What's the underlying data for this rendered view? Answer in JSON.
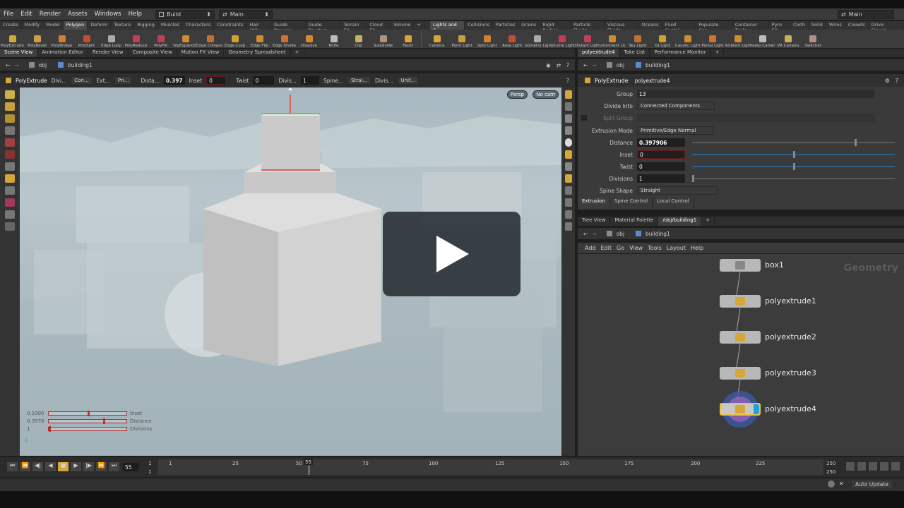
{
  "menubar": {
    "items": [
      "File",
      "Edit",
      "Render",
      "Assets",
      "Windows",
      "Help"
    ],
    "desktop": "Build",
    "desktop_icon": "grid-icon",
    "session": "Main",
    "right_session": "Main"
  },
  "shelf_tabs_left": [
    "Create",
    "Modify",
    "Model",
    "Polygon",
    "Deform",
    "Texture",
    "Rigging",
    "Muscles",
    "Characters",
    "Constraints",
    "Hair Utils",
    "Guide Process",
    "Guide Brushes",
    "Terrain FX",
    "Cloud FX",
    "Volume"
  ],
  "shelf_tabs_right": [
    "Lights and C...",
    "Collisions",
    "Particles",
    "Grains",
    "Rigid Bodies",
    "Particle Fluids",
    "Viscous Fluids",
    "Oceans",
    "Fluid Contai...",
    "Populate Con...",
    "Container Tools",
    "Pyro FX",
    "Cloth",
    "Solid",
    "Wires",
    "Crowds",
    "Drive Simula..."
  ],
  "shelf_tools_left": [
    "PolyExtrude",
    "PolyBevel",
    "PolyBridge",
    "PolySplit",
    "Edge Loop",
    "PolyReduce",
    "PolyFill",
    "PolyExpand2D",
    "Edge Collapse",
    "Edge Cusp",
    "Edge Flip",
    "Edge Divide",
    "Dissolve",
    "Knife",
    "Clip",
    "Subdivide",
    "Facet"
  ],
  "shelf_tools_right": [
    "Camera",
    "Point Light",
    "Spot Light",
    "Area Light",
    "Geometry Light",
    "Volume Light",
    "Distant Light",
    "Environment Light",
    "Sky Light",
    "GI Light",
    "Caustic Light",
    "Portal Light",
    "Ambient Light",
    "Stereo Camera",
    "VR Camera",
    "Switcher"
  ],
  "left_pane_tabs": [
    "Scene View",
    "Animation Editor",
    "Render View",
    "Composite View",
    "Motion FX View",
    "Geometry Spreadsheet"
  ],
  "left_path": {
    "root": "obj",
    "node": "building1"
  },
  "opbar": {
    "op": "PolyExtrude",
    "divide_label": "Divi...",
    "divide_val": "Con...",
    "ext_label": "Ext...",
    "ext_val": "Pri...",
    "dist_label": "Dista...",
    "dist_val": "0.397",
    "inset_label": "Inset",
    "inset_val": "0",
    "twist_label": "Twist",
    "twist_val": "0",
    "divs_label": "Divis...",
    "divs_val": "1",
    "spine_label": "Spine...",
    "spine_val": "Strai...",
    "divs2_label": "Divis...",
    "divs2_val": "Unif..."
  },
  "viewport": {
    "camera": "Persp",
    "cam_menu": "No cam",
    "handles": [
      {
        "value": "0.1000",
        "label": "Inset",
        "fill": 0.5
      },
      {
        "value": "0.3978",
        "label": "Distance",
        "fill": 0.7
      },
      {
        "value": "1",
        "label": "Divisions",
        "fill": 0.0
      }
    ]
  },
  "timeline": {
    "frame": "55",
    "start": "1",
    "start2": "1",
    "end": "250",
    "end2": "250",
    "ticks": [
      "1",
      "25",
      "50",
      "75",
      "100",
      "125",
      "150",
      "175",
      "200",
      "225"
    ],
    "current_tick": "55"
  },
  "status": {
    "auto_update": "Auto Update"
  },
  "right_pane_tabs": [
    "polyextrude4",
    "Take List",
    "Performance Monitor"
  ],
  "right_path": {
    "root": "obj",
    "node": "building1"
  },
  "params": {
    "type": "PolyExtrude",
    "name": "polyextrude4",
    "group_label": "Group",
    "group_val": "13",
    "divide_label": "Divide Into",
    "divide_val": "Connected Components",
    "split_label": "Split Group",
    "mode_label": "Extrusion Mode",
    "mode_val": "Primitive/Edge Normal",
    "distance_label": "Distance",
    "distance_val": "0.397906",
    "distance_level": 0.8,
    "inset_label": "Inset",
    "inset_val": "0",
    "twist_label": "Twist",
    "twist_val": "0",
    "div_label": "Divisions",
    "div_val": "1",
    "spine_label": "Spine Shape",
    "spine_val": "Straight",
    "tabs": [
      "Extrusion",
      "Spine Control",
      "Local Control"
    ]
  },
  "network_tabs": [
    "Tree View",
    "Material Palette",
    "/obj/building1"
  ],
  "network_path": {
    "root": "obj",
    "node": "building1"
  },
  "network_menu": [
    "Add",
    "Edit",
    "Go",
    "View",
    "Tools",
    "Layout",
    "Help"
  ],
  "network": {
    "context": "Geometry",
    "nodes": [
      "box1",
      "polyextrude1",
      "polyextrude2",
      "polyextrude3",
      "polyextrude4"
    ]
  }
}
